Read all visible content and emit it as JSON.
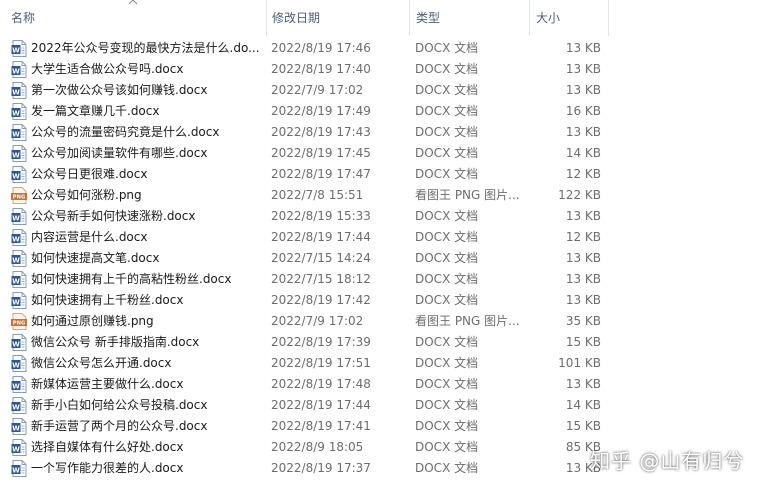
{
  "columns": {
    "name": "名称",
    "date": "修改日期",
    "type": "类型",
    "size": "大小"
  },
  "files": [
    {
      "name": "2022年公众号变现的最快方法是什么.do...",
      "date": "2022/8/19 17:46",
      "type": "DOCX 文档",
      "size": "13 KB",
      "icon": "docx-icon"
    },
    {
      "name": "大学生适合做公众号吗.docx",
      "date": "2022/8/19 17:40",
      "type": "DOCX 文档",
      "size": "13 KB",
      "icon": "docx-icon"
    },
    {
      "name": "第一次做公众号该如何赚钱.docx",
      "date": "2022/7/9 17:02",
      "type": "DOCX 文档",
      "size": "13 KB",
      "icon": "docx-icon"
    },
    {
      "name": "发一篇文章赚几千.docx",
      "date": "2022/8/19 17:49",
      "type": "DOCX 文档",
      "size": "16 KB",
      "icon": "docx-icon"
    },
    {
      "name": "公众号的流量密码究竟是什么.docx",
      "date": "2022/8/19 17:43",
      "type": "DOCX 文档",
      "size": "13 KB",
      "icon": "docx-icon"
    },
    {
      "name": "公众号加阅读量软件有哪些.docx",
      "date": "2022/8/19 17:45",
      "type": "DOCX 文档",
      "size": "14 KB",
      "icon": "docx-icon"
    },
    {
      "name": "公众号日更很难.docx",
      "date": "2022/8/19 17:47",
      "type": "DOCX 文档",
      "size": "12 KB",
      "icon": "docx-icon"
    },
    {
      "name": "公众号如何涨粉.png",
      "date": "2022/7/8 15:51",
      "type": "看图王 PNG 图片...",
      "size": "122 KB",
      "icon": "png-icon"
    },
    {
      "name": "公众号新手如何快速涨粉.docx",
      "date": "2022/8/19 15:33",
      "type": "DOCX 文档",
      "size": "13 KB",
      "icon": "docx-icon"
    },
    {
      "name": "内容运营是什么.docx",
      "date": "2022/8/19 17:44",
      "type": "DOCX 文档",
      "size": "12 KB",
      "icon": "docx-icon"
    },
    {
      "name": "如何快速提高文笔.docx",
      "date": "2022/7/15 14:24",
      "type": "DOCX 文档",
      "size": "13 KB",
      "icon": "docx-icon"
    },
    {
      "name": "如何快速拥有上千的高粘性粉丝.docx",
      "date": "2022/7/15 18:12",
      "type": "DOCX 文档",
      "size": "13 KB",
      "icon": "docx-icon"
    },
    {
      "name": "如何快速拥有上千粉丝.docx",
      "date": "2022/8/19 17:42",
      "type": "DOCX 文档",
      "size": "13 KB",
      "icon": "docx-icon"
    },
    {
      "name": "如何通过原创赚钱.png",
      "date": "2022/7/9 17:02",
      "type": "看图王 PNG 图片...",
      "size": "35 KB",
      "icon": "png-icon"
    },
    {
      "name": "微信公众号 新手排版指南.docx",
      "date": "2022/8/19 17:39",
      "type": "DOCX 文档",
      "size": "15 KB",
      "icon": "docx-icon"
    },
    {
      "name": "微信公众号怎么开通.docx",
      "date": "2022/8/19 17:51",
      "type": "DOCX 文档",
      "size": "101 KB",
      "icon": "docx-icon"
    },
    {
      "name": "新媒体运营主要做什么.docx",
      "date": "2022/8/19 17:48",
      "type": "DOCX 文档",
      "size": "13 KB",
      "icon": "docx-icon"
    },
    {
      "name": "新手小白如何给公众号投稿.docx",
      "date": "2022/8/19 17:44",
      "type": "DOCX 文档",
      "size": "14 KB",
      "icon": "docx-icon"
    },
    {
      "name": "新手运营了两个月的公众号.docx",
      "date": "2022/8/19 17:41",
      "type": "DOCX 文档",
      "size": "15 KB",
      "icon": "docx-icon"
    },
    {
      "name": "选择自媒体有什么好处.docx",
      "date": "2022/8/9 18:05",
      "type": "DOCX 文档",
      "size": "85 KB",
      "icon": "docx-icon"
    },
    {
      "name": "一个写作能力很差的人.docx",
      "date": "2022/8/19 17:37",
      "type": "DOCX 文档",
      "size": "13 KB",
      "icon": "docx-icon"
    }
  ],
  "watermark": "知乎 @山有归兮",
  "colors": {
    "header_text": "#4c607a",
    "docx_icon": "#2b5797",
    "png_icon": "#c8733a",
    "secondary_text": "#6d6d6d"
  }
}
